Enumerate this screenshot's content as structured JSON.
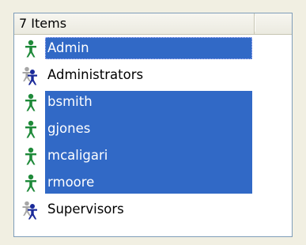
{
  "header": {
    "column_label": "7 Items"
  },
  "items": [
    {
      "label": "Admin",
      "type": "user",
      "selected": true,
      "focused": true
    },
    {
      "label": "Administrators",
      "type": "group",
      "selected": false
    },
    {
      "label": "bsmith",
      "type": "user",
      "selected": true
    },
    {
      "label": "gjones",
      "type": "user",
      "selected": true
    },
    {
      "label": "mcaligari",
      "type": "user",
      "selected": true
    },
    {
      "label": "rmoore",
      "type": "user",
      "selected": true
    },
    {
      "label": "Supervisors",
      "type": "group",
      "selected": false
    }
  ],
  "colors": {
    "selection": "#3169c6",
    "user_icon": "#1f8a3a",
    "group_icon_front": "#1a2a9a",
    "group_icon_back": "#9a9a9a"
  },
  "icons": {
    "user": "user-icon",
    "group": "group-icon"
  }
}
